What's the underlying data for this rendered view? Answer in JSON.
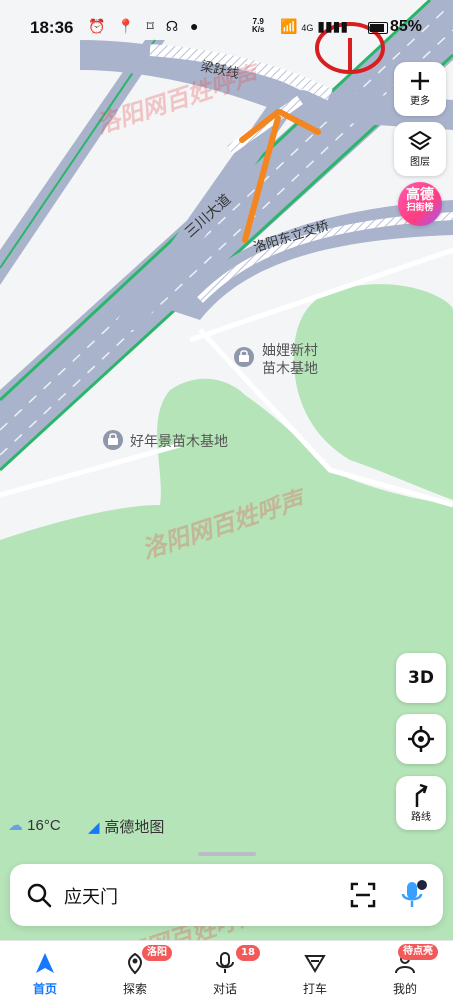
{
  "status": {
    "time": "18:36",
    "net_speed_value": "7.9",
    "net_speed_unit": "K/s",
    "network": "4G",
    "battery": "85%"
  },
  "map": {
    "road_labels": [
      "梁跃线",
      "三川大道",
      "洛阳东立交桥"
    ],
    "pois": [
      {
        "name_line1": "妯娌新村",
        "name_line2": "苗木基地"
      },
      {
        "name_line1": "好年景苗木基地",
        "name_line2": ""
      }
    ]
  },
  "controls": {
    "more_label": "更多",
    "layer_label": "图层",
    "gaode_title": "高德",
    "gaode_subtitle": "扫街榜",
    "three_d_label": "3D",
    "route_label": "路线"
  },
  "weather": {
    "temp": "16°C"
  },
  "brand": {
    "name": "高德地图"
  },
  "search": {
    "value": "应天门"
  },
  "tabs": [
    {
      "label": "首页",
      "badge": ""
    },
    {
      "label": "探索",
      "badge": "洛阳"
    },
    {
      "label": "对话",
      "badge": "18"
    },
    {
      "label": "打车",
      "badge": ""
    },
    {
      "label": "我的",
      "badge": "待点亮"
    }
  ],
  "watermarks": [
    "洛阳网",
    "百姓呼声"
  ],
  "colors": {
    "accent": "#1677ff",
    "road": "#a9b4cc",
    "green": "#b5e4b8",
    "highlight": "#2bb56a",
    "arrow": "#f4861f",
    "circle": "#d81e1e"
  }
}
